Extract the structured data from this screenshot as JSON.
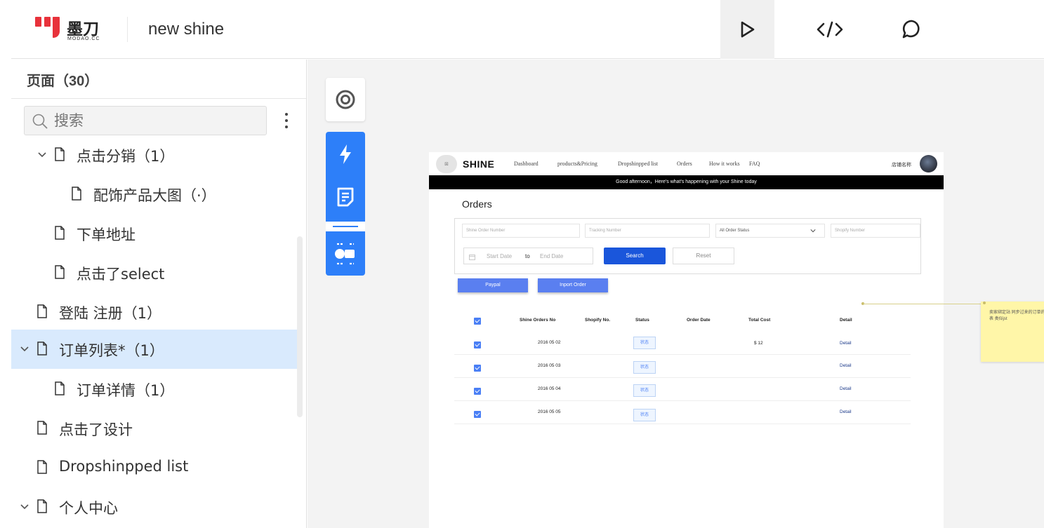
{
  "app": {
    "logo_cn": "墨刀",
    "logo_en": "MODAO.CC",
    "project_title": "new shine"
  },
  "toolbar": {
    "play_icon": "play-icon",
    "code_icon": "code-icon",
    "comment_icon": "comment-icon"
  },
  "sidebar": {
    "title": "页面（30）",
    "search_placeholder": "搜索",
    "items": [
      {
        "label": "点击分销（1）",
        "expanded": true
      },
      {
        "label": "配饰产品大图（·）"
      },
      {
        "label": "下单地址"
      },
      {
        "label": "点击了select"
      },
      {
        "label": "登陆 注册（1）"
      },
      {
        "label": "订单列表*（1）",
        "expanded": true,
        "active": true
      },
      {
        "label": "订单详情（1）"
      },
      {
        "label": "点击了设计"
      },
      {
        "label": "Dropshinpped list"
      },
      {
        "label": "个人中心",
        "expanded": true
      }
    ]
  },
  "canvas_tools": [
    "target-icon",
    "lightning-icon",
    "note-icon",
    "components-icon"
  ],
  "prototype": {
    "logo_placeholder": "⊠",
    "brand": "SHINE",
    "nav_links": [
      "Dashboard",
      "products&Pricing",
      "Dropshinpped list",
      "Orders",
      "How it works",
      "FAQ"
    ],
    "store_name": "店铺名称",
    "banner": "Good afternoon，Here's what's happening with your Shine today",
    "page_title": "Orders",
    "filters": {
      "order_number": "Shine Order Number",
      "tracking_number": "Tracking Number",
      "status_select": "All Order Status",
      "shopify_number": "Shopify Number",
      "start_date": "Start Date",
      "to": "to",
      "end_date": "End Date",
      "search": "Search",
      "reset": "Reset"
    },
    "actions": {
      "paypal": "Paypal",
      "import": "Inport Order"
    },
    "columns": [
      "Shine Orders No",
      "Shopify No.",
      "Status",
      "Order Date",
      "Total Cost",
      "Detail"
    ],
    "rows": [
      {
        "order_no": "2016 05 02",
        "status": "状态",
        "total": "$ 12",
        "detail": "Detail"
      },
      {
        "order_no": "2016 05 03",
        "status": "状态",
        "total": "",
        "detail": "Detail"
      },
      {
        "order_no": "2016 05 04",
        "status": "状态",
        "total": "",
        "detail": "Detail"
      },
      {
        "order_no": "2016 05 05",
        "status": "状态",
        "total": "",
        "detail": "Detail"
      }
    ]
  },
  "annotation": {
    "text": "卖家绑定站 同步过来的订单的列表 类似jst"
  }
}
